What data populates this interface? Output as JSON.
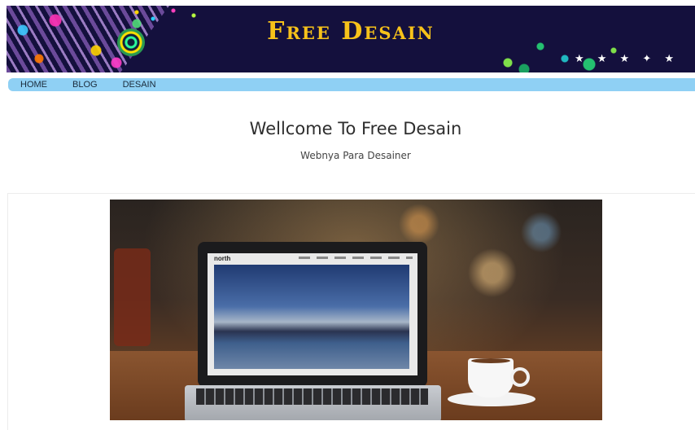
{
  "site": {
    "banner_title": "Free Desain"
  },
  "nav": {
    "items": [
      {
        "label": "HOME"
      },
      {
        "label": "BLOG"
      },
      {
        "label": "DESAIN"
      }
    ]
  },
  "hero": {
    "heading": "Wellcome To Free Desain",
    "subheading": "Webnya Para Desainer"
  },
  "featured_image": {
    "laptop_site_brand": "north"
  },
  "colors": {
    "banner_bg": "#14103d",
    "banner_title": "#f7c21a",
    "nav_bg": "#8fd0f4"
  }
}
